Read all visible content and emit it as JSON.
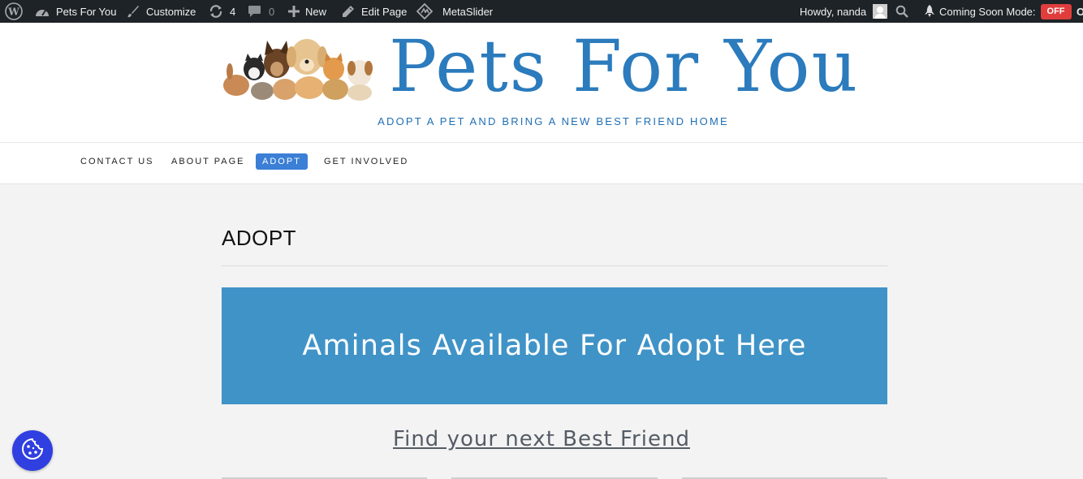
{
  "adminbar": {
    "site_name": "Pets For You",
    "customize": "Customize",
    "updates_count": "4",
    "comments_count": "0",
    "new_label": "New",
    "edit_page": "Edit Page",
    "metaslider": "MetaSlider",
    "howdy": "Howdy, nanda",
    "coming_soon_label": "Coming Soon Mode:",
    "coming_soon_state": "OFF",
    "edge_text": "O"
  },
  "header": {
    "site_title": "Pets For You",
    "tagline": "ADOPT A PET AND BRING A NEW BEST FRIEND HOME"
  },
  "nav": {
    "items": [
      {
        "label": "CONTACT US",
        "active": false
      },
      {
        "label": "ABOUT PAGE",
        "active": false
      },
      {
        "label": "ADOPT",
        "active": true
      },
      {
        "label": "GET INVOLVED",
        "active": false
      }
    ]
  },
  "content": {
    "page_title": "ADOPT",
    "banner_text": "Aminals Available For Adopt Here",
    "subhead_link": "Find your next Best Friend"
  },
  "colors": {
    "adminbar_bg": "#1d2327",
    "brand_blue": "#2b7bbd",
    "banner_blue": "#4093c7",
    "nav_active": "#3b7fd6",
    "coming_soon_off": "#e03d3d",
    "cookie_button": "#2f3fe0"
  },
  "icons": {
    "wp_logo": "wordpress-icon",
    "dashboard": "dashboard-icon",
    "customize": "brush-icon",
    "updates": "updates-icon",
    "comments": "comment-icon",
    "new": "plus-icon",
    "edit": "pencil-icon",
    "metaslider": "metaslider-icon",
    "search": "search-icon",
    "rocket": "rocket-icon",
    "cookie": "cookie-icon"
  }
}
